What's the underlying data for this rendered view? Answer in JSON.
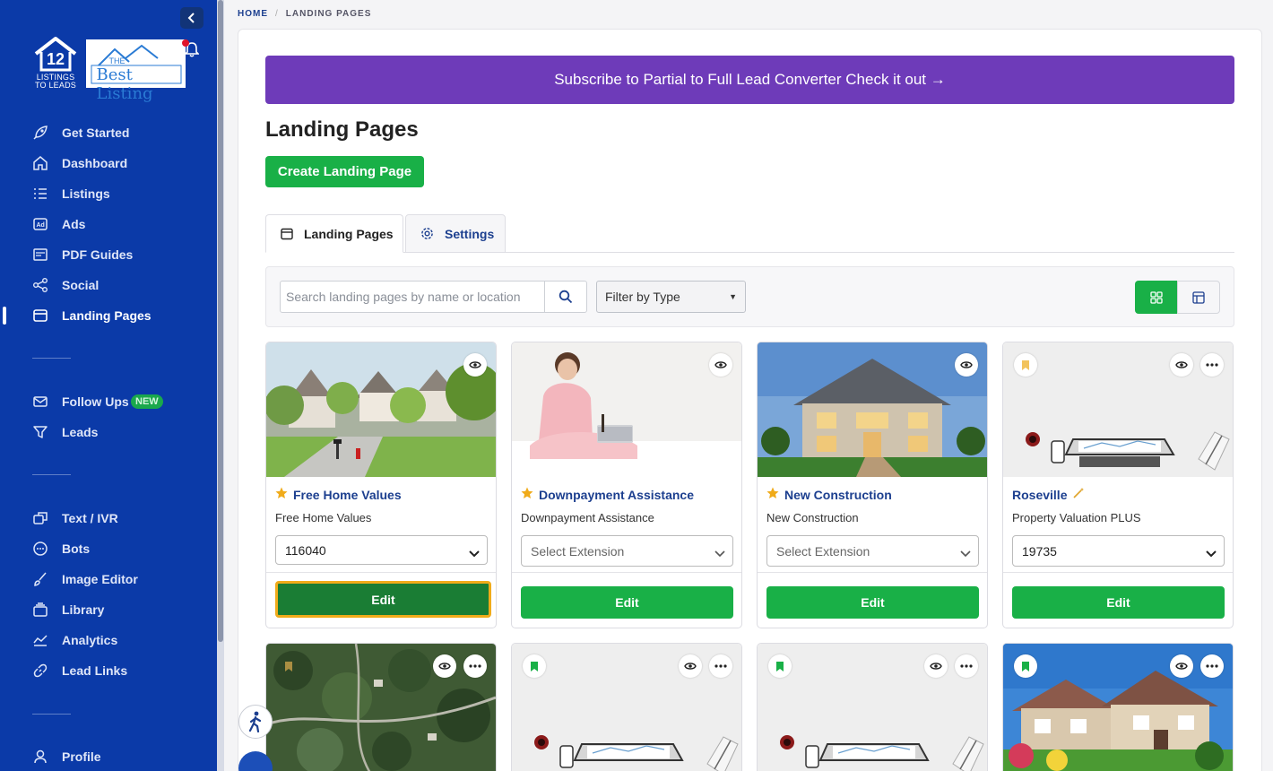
{
  "brand": {
    "logo_number": "12",
    "logo_line1": "LISTINGS",
    "logo_line2": "TO LEADS",
    "partner_the": "THE",
    "partner_name": "Best Listing"
  },
  "sidebar": {
    "items": [
      {
        "label": "Get Started",
        "icon": "rocket-icon"
      },
      {
        "label": "Dashboard",
        "icon": "home-icon"
      },
      {
        "label": "Listings",
        "icon": "list-icon"
      },
      {
        "label": "Ads",
        "icon": "ad-icon"
      },
      {
        "label": "PDF Guides",
        "icon": "pdf-icon"
      },
      {
        "label": "Social",
        "icon": "share-icon"
      },
      {
        "label": "Landing Pages",
        "icon": "window-icon",
        "active": true
      },
      {
        "label": "Follow Ups",
        "icon": "mail-icon",
        "badge": "NEW"
      },
      {
        "label": "Leads",
        "icon": "filter-icon"
      },
      {
        "label": "Text / IVR",
        "icon": "chat-share-icon"
      },
      {
        "label": "Bots",
        "icon": "chat-bubble-icon"
      },
      {
        "label": "Image Editor",
        "icon": "brush-icon"
      },
      {
        "label": "Library",
        "icon": "stack-icon"
      },
      {
        "label": "Analytics",
        "icon": "analytics-icon"
      },
      {
        "label": "Lead Links",
        "icon": "link-icon"
      },
      {
        "label": "Profile",
        "icon": "user-icon"
      }
    ]
  },
  "breadcrumb": {
    "home": "HOME",
    "sep": "/",
    "current": "LANDING PAGES"
  },
  "banner": "Subscribe to Partial to Full Lead Converter Check it out →",
  "page_title": "Landing Pages",
  "create_button": "Create Landing Page",
  "tabs": [
    {
      "label": "Landing Pages",
      "active": true
    },
    {
      "label": "Settings",
      "active": false
    }
  ],
  "search": {
    "placeholder": "Search landing pages by name or location"
  },
  "filter": {
    "selected": "Filter by Type"
  },
  "cards": [
    {
      "title": "Free Home Values",
      "subtitle": "Free Home Values",
      "select": "116040",
      "edit": "Edit",
      "starred": true
    },
    {
      "title": "Downpayment Assistance",
      "subtitle": "Downpayment Assistance",
      "select": "Select Extension",
      "edit": "Edit",
      "starred": true
    },
    {
      "title": "New Construction",
      "subtitle": "New Construction",
      "select": "Select Extension",
      "edit": "Edit",
      "starred": true
    },
    {
      "title": "Roseville",
      "subtitle": "Property Valuation PLUS",
      "select": "19735",
      "edit": "Edit",
      "starred": false
    }
  ],
  "colors": {
    "sidebar": "#0b3aa8",
    "accent_green": "#19b047",
    "banner_purple": "#6e3bb9",
    "link_blue": "#1c3f8f",
    "star": "#f0ab1a"
  }
}
